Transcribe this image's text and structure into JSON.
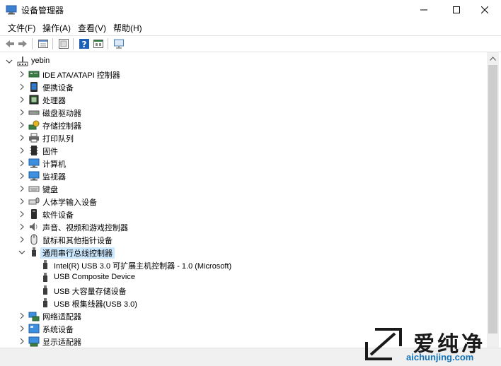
{
  "window": {
    "title": "设备管理器",
    "controls": [
      "minimize-icon",
      "maximize-icon",
      "close-icon"
    ]
  },
  "menu": [
    "文件(F)",
    "操作(A)",
    "查看(V)",
    "帮助(H)"
  ],
  "toolbar": {
    "icons": [
      "back-arrow-icon",
      "forward-arrow-icon",
      "properties-icon",
      "view-icon",
      "help-icon",
      "show-hidden-icon",
      "monitor-icon"
    ]
  },
  "tree": {
    "root": "yebin",
    "categories": [
      {
        "label": "IDE ATA/ATAPI 控制器",
        "icon": "ide-controller-icon"
      },
      {
        "label": "便携设备",
        "icon": "portable-device-icon"
      },
      {
        "label": "处理器",
        "icon": "processor-icon"
      },
      {
        "label": "磁盘驱动器",
        "icon": "disk-drive-icon"
      },
      {
        "label": "存储控制器",
        "icon": "storage-controller-icon"
      },
      {
        "label": "打印队列",
        "icon": "printer-icon"
      },
      {
        "label": "固件",
        "icon": "firmware-icon"
      },
      {
        "label": "计算机",
        "icon": "computer-icon"
      },
      {
        "label": "监视器",
        "icon": "monitor-icon"
      },
      {
        "label": "键盘",
        "icon": "keyboard-icon"
      },
      {
        "label": "人体学输入设备",
        "icon": "hid-icon"
      },
      {
        "label": "软件设备",
        "icon": "software-device-icon"
      },
      {
        "label": "声音、视频和游戏控制器",
        "icon": "speaker-icon"
      },
      {
        "label": "鼠标和其他指针设备",
        "icon": "mouse-icon"
      },
      {
        "label": "通用串行总线控制器",
        "icon": "usb-icon"
      }
    ],
    "usb_children": [
      "Intel(R) USB 3.0 可扩展主机控制器 - 1.0 (Microsoft)",
      "USB Composite Device",
      "USB 大容量存储设备",
      "USB 根集线器(USB 3.0)"
    ],
    "after_categories": [
      {
        "label": "网络适配器",
        "icon": "network-adapter-icon"
      },
      {
        "label": "系统设备",
        "icon": "system-device-icon"
      },
      {
        "label": "显示适配器",
        "icon": "display-adapter-icon"
      }
    ]
  },
  "watermark": {
    "text": "爱纯净",
    "url": "aichunjing.com"
  }
}
